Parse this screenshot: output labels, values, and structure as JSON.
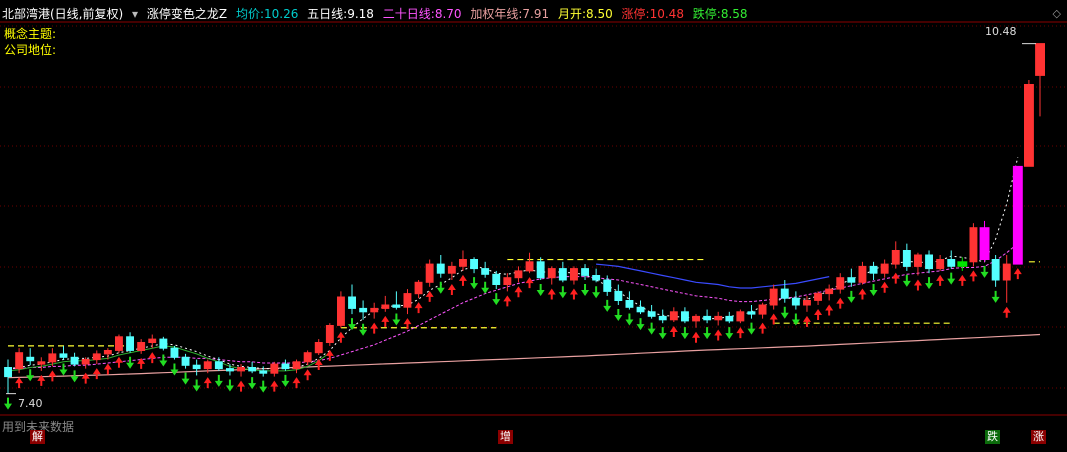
{
  "header": {
    "stock": "北部湾港(日线,前复权)",
    "indicator": "涨停变色之龙Z",
    "avg_label": "均价:",
    "avg_value": "10.26",
    "ma5_label": "五日线:",
    "ma5_value": "9.18",
    "ma20_label": "二十日线:",
    "ma20_value": "8.70",
    "wma_label": "加权年线:",
    "wma_value": "7.91",
    "open_label": "月开:",
    "open_value": "8.50",
    "up_label": "涨停:",
    "up_value": "10.48",
    "down_label": "跌停:",
    "down_value": "8.58"
  },
  "side": {
    "concept": "概念主题:",
    "position": "公司地位:"
  },
  "footer": {
    "note": "用到未来数据"
  },
  "markers": {
    "jie": "解",
    "zeng": "增",
    "die": "跌",
    "zhang": "涨"
  },
  "price_labels": {
    "high": "10.48",
    "low": "7.40"
  },
  "icons": {
    "collapse": "chevron-down-icon",
    "diamond": "diamond-icon"
  },
  "colors": {
    "up": "#ff3333",
    "down": "#54ffff",
    "limit_up": "#ff00ff",
    "limit_down": "#00e600",
    "ma5": "#ffffff",
    "ma20": "#ff55ff",
    "blue_line": "#3a4bff",
    "green_line": "#2fae2f",
    "year_line": "#e8a0a0",
    "dash": "#ffff33",
    "grid": "#6b0000"
  },
  "chart_data": {
    "type": "candlestick",
    "ylim": [
      7.3,
      10.6
    ],
    "candles": [
      {
        "o": 7.63,
        "h": 7.7,
        "l": 7.4,
        "c": 7.55
      },
      {
        "o": 7.62,
        "h": 7.8,
        "l": 7.58,
        "c": 7.76
      },
      {
        "o": 7.72,
        "h": 7.8,
        "l": 7.65,
        "c": 7.69
      },
      {
        "o": 7.66,
        "h": 7.72,
        "l": 7.6,
        "c": 7.68
      },
      {
        "o": 7.68,
        "h": 7.8,
        "l": 7.64,
        "c": 7.75
      },
      {
        "o": 7.75,
        "h": 7.82,
        "l": 7.7,
        "c": 7.72
      },
      {
        "o": 7.72,
        "h": 7.76,
        "l": 7.64,
        "c": 7.66
      },
      {
        "o": 7.66,
        "h": 7.72,
        "l": 7.62,
        "c": 7.7
      },
      {
        "o": 7.7,
        "h": 7.78,
        "l": 7.66,
        "c": 7.75
      },
      {
        "o": 7.75,
        "h": 7.8,
        "l": 7.7,
        "c": 7.78
      },
      {
        "o": 7.78,
        "h": 7.92,
        "l": 7.76,
        "c": 7.9
      },
      {
        "o": 7.9,
        "h": 7.94,
        "l": 7.76,
        "c": 7.78
      },
      {
        "o": 7.78,
        "h": 7.88,
        "l": 7.75,
        "c": 7.85
      },
      {
        "o": 7.85,
        "h": 7.92,
        "l": 7.8,
        "c": 7.88
      },
      {
        "o": 7.88,
        "h": 7.9,
        "l": 7.78,
        "c": 7.8
      },
      {
        "o": 7.8,
        "h": 7.82,
        "l": 7.7,
        "c": 7.72
      },
      {
        "o": 7.72,
        "h": 7.75,
        "l": 7.62,
        "c": 7.65
      },
      {
        "o": 7.65,
        "h": 7.7,
        "l": 7.56,
        "c": 7.62
      },
      {
        "o": 7.62,
        "h": 7.7,
        "l": 7.58,
        "c": 7.68
      },
      {
        "o": 7.68,
        "h": 7.72,
        "l": 7.6,
        "c": 7.62
      },
      {
        "o": 7.62,
        "h": 7.66,
        "l": 7.56,
        "c": 7.6
      },
      {
        "o": 7.6,
        "h": 7.66,
        "l": 7.55,
        "c": 7.63
      },
      {
        "o": 7.63,
        "h": 7.68,
        "l": 7.58,
        "c": 7.6
      },
      {
        "o": 7.6,
        "h": 7.64,
        "l": 7.55,
        "c": 7.58
      },
      {
        "o": 7.58,
        "h": 7.68,
        "l": 7.55,
        "c": 7.66
      },
      {
        "o": 7.66,
        "h": 7.7,
        "l": 7.6,
        "c": 7.62
      },
      {
        "o": 7.62,
        "h": 7.7,
        "l": 7.58,
        "c": 7.68
      },
      {
        "o": 7.68,
        "h": 7.78,
        "l": 7.65,
        "c": 7.76
      },
      {
        "o": 7.76,
        "h": 7.88,
        "l": 7.74,
        "c": 7.85
      },
      {
        "o": 7.85,
        "h": 8.02,
        "l": 7.82,
        "c": 8.0
      },
      {
        "o": 8.0,
        "h": 8.3,
        "l": 7.98,
        "c": 8.25
      },
      {
        "o": 8.25,
        "h": 8.36,
        "l": 8.1,
        "c": 8.15
      },
      {
        "o": 8.15,
        "h": 8.22,
        "l": 8.05,
        "c": 8.12
      },
      {
        "o": 8.12,
        "h": 8.2,
        "l": 8.06,
        "c": 8.15
      },
      {
        "o": 8.15,
        "h": 8.26,
        "l": 8.12,
        "c": 8.18
      },
      {
        "o": 8.18,
        "h": 8.3,
        "l": 8.14,
        "c": 8.16
      },
      {
        "o": 8.16,
        "h": 8.32,
        "l": 8.1,
        "c": 8.28
      },
      {
        "o": 8.28,
        "h": 8.4,
        "l": 8.24,
        "c": 8.38
      },
      {
        "o": 8.38,
        "h": 8.58,
        "l": 8.34,
        "c": 8.54
      },
      {
        "o": 8.54,
        "h": 8.62,
        "l": 8.42,
        "c": 8.46
      },
      {
        "o": 8.46,
        "h": 8.56,
        "l": 8.4,
        "c": 8.52
      },
      {
        "o": 8.52,
        "h": 8.66,
        "l": 8.48,
        "c": 8.58
      },
      {
        "o": 8.58,
        "h": 8.6,
        "l": 8.46,
        "c": 8.5
      },
      {
        "o": 8.5,
        "h": 8.56,
        "l": 8.42,
        "c": 8.45
      },
      {
        "o": 8.45,
        "h": 8.48,
        "l": 8.32,
        "c": 8.36
      },
      {
        "o": 8.36,
        "h": 8.46,
        "l": 8.3,
        "c": 8.42
      },
      {
        "o": 8.42,
        "h": 8.52,
        "l": 8.38,
        "c": 8.48
      },
      {
        "o": 8.48,
        "h": 8.64,
        "l": 8.46,
        "c": 8.56
      },
      {
        "o": 8.56,
        "h": 8.6,
        "l": 8.4,
        "c": 8.42
      },
      {
        "o": 8.42,
        "h": 8.52,
        "l": 8.36,
        "c": 8.5
      },
      {
        "o": 8.5,
        "h": 8.56,
        "l": 8.38,
        "c": 8.4
      },
      {
        "o": 8.4,
        "h": 8.52,
        "l": 8.36,
        "c": 8.5
      },
      {
        "o": 8.5,
        "h": 8.54,
        "l": 8.4,
        "c": 8.44
      },
      {
        "o": 8.44,
        "h": 8.5,
        "l": 8.38,
        "c": 8.4
      },
      {
        "o": 8.4,
        "h": 8.44,
        "l": 8.26,
        "c": 8.3
      },
      {
        "o": 8.3,
        "h": 8.36,
        "l": 8.18,
        "c": 8.22
      },
      {
        "o": 8.22,
        "h": 8.3,
        "l": 8.14,
        "c": 8.16
      },
      {
        "o": 8.16,
        "h": 8.22,
        "l": 8.1,
        "c": 8.12
      },
      {
        "o": 8.12,
        "h": 8.18,
        "l": 8.06,
        "c": 8.08
      },
      {
        "o": 8.08,
        "h": 8.14,
        "l": 8.02,
        "c": 8.05
      },
      {
        "o": 8.05,
        "h": 8.16,
        "l": 8.03,
        "c": 8.12
      },
      {
        "o": 8.12,
        "h": 8.16,
        "l": 8.02,
        "c": 8.04
      },
      {
        "o": 8.04,
        "h": 8.1,
        "l": 7.98,
        "c": 8.08
      },
      {
        "o": 8.08,
        "h": 8.14,
        "l": 8.02,
        "c": 8.05
      },
      {
        "o": 8.05,
        "h": 8.12,
        "l": 8.0,
        "c": 8.08
      },
      {
        "o": 8.08,
        "h": 8.12,
        "l": 8.02,
        "c": 8.04
      },
      {
        "o": 8.04,
        "h": 8.14,
        "l": 8.02,
        "c": 8.12
      },
      {
        "o": 8.12,
        "h": 8.18,
        "l": 8.06,
        "c": 8.1
      },
      {
        "o": 8.1,
        "h": 8.2,
        "l": 8.06,
        "c": 8.18
      },
      {
        "o": 8.18,
        "h": 8.36,
        "l": 8.14,
        "c": 8.32
      },
      {
        "o": 8.32,
        "h": 8.4,
        "l": 8.2,
        "c": 8.24
      },
      {
        "o": 8.24,
        "h": 8.3,
        "l": 8.14,
        "c": 8.18
      },
      {
        "o": 8.18,
        "h": 8.26,
        "l": 8.12,
        "c": 8.22
      },
      {
        "o": 8.22,
        "h": 8.3,
        "l": 8.18,
        "c": 8.28
      },
      {
        "o": 8.28,
        "h": 8.36,
        "l": 8.22,
        "c": 8.32
      },
      {
        "o": 8.32,
        "h": 8.46,
        "l": 8.28,
        "c": 8.42
      },
      {
        "o": 8.42,
        "h": 8.5,
        "l": 8.34,
        "c": 8.38
      },
      {
        "o": 8.38,
        "h": 8.56,
        "l": 8.36,
        "c": 8.52
      },
      {
        "o": 8.52,
        "h": 8.56,
        "l": 8.4,
        "c": 8.46
      },
      {
        "o": 8.46,
        "h": 8.58,
        "l": 8.42,
        "c": 8.54
      },
      {
        "o": 8.54,
        "h": 8.74,
        "l": 8.5,
        "c": 8.66
      },
      {
        "o": 8.66,
        "h": 8.72,
        "l": 8.48,
        "c": 8.52
      },
      {
        "o": 8.52,
        "h": 8.64,
        "l": 8.44,
        "c": 8.62
      },
      {
        "o": 8.62,
        "h": 8.66,
        "l": 8.46,
        "c": 8.5
      },
      {
        "o": 8.5,
        "h": 8.62,
        "l": 8.48,
        "c": 8.58
      },
      {
        "o": 8.58,
        "h": 8.66,
        "l": 8.5,
        "c": 8.52
      },
      {
        "o": 8.52,
        "h": 8.6,
        "l": 8.48,
        "c": 8.56
      },
      {
        "o": 8.56,
        "h": 8.9,
        "l": 8.52,
        "c": 8.86
      },
      {
        "o": 8.86,
        "h": 8.92,
        "l": 8.56,
        "c": 8.58
      },
      {
        "o": 8.58,
        "h": 8.62,
        "l": 8.34,
        "c": 8.4
      },
      {
        "o": 8.4,
        "h": 8.62,
        "l": 8.2,
        "c": 8.54
      },
      {
        "o": 8.54,
        "h": 9.4,
        "l": 8.54,
        "c": 9.4
      },
      {
        "o": 9.4,
        "h": 10.16,
        "l": 9.4,
        "c": 10.12
      },
      {
        "o": 10.2,
        "h": 10.48,
        "l": 9.84,
        "c": 10.48
      }
    ],
    "limit_up_index": [
      88,
      91
    ],
    "limit_down_index": [
      86
    ],
    "ma5": [
      7.62,
      7.63,
      7.65,
      7.66,
      7.68,
      7.7,
      7.71,
      7.71,
      7.72,
      7.73,
      7.76,
      7.78,
      7.8,
      7.82,
      7.84,
      7.83,
      7.8,
      7.77,
      7.73,
      7.7,
      7.66,
      7.64,
      7.63,
      7.62,
      7.62,
      7.62,
      7.63,
      7.66,
      7.71,
      7.78,
      7.89,
      7.98,
      8.06,
      8.13,
      8.17,
      8.17,
      8.18,
      8.23,
      8.31,
      8.36,
      8.42,
      8.49,
      8.52,
      8.5,
      8.46,
      8.45,
      8.47,
      8.49,
      8.47,
      8.47,
      8.47,
      8.46,
      8.45,
      8.4,
      8.35,
      8.3,
      8.23,
      8.17,
      8.11,
      8.09,
      8.08,
      8.07,
      8.07,
      8.06,
      8.06,
      8.08,
      8.09,
      8.12,
      8.17,
      8.21,
      8.24,
      8.24,
      8.23,
      8.26,
      8.31,
      8.36,
      8.41,
      8.44,
      8.49,
      8.53,
      8.55,
      8.56,
      8.56,
      8.55,
      8.57,
      8.61,
      8.6,
      8.58,
      8.56,
      8.76,
      9.07,
      9.48
    ],
    "ma20": [
      7.62,
      7.62,
      7.63,
      7.63,
      7.64,
      7.64,
      7.65,
      7.65,
      7.66,
      7.67,
      7.68,
      7.69,
      7.7,
      7.71,
      7.72,
      7.72,
      7.72,
      7.71,
      7.71,
      7.7,
      7.69,
      7.68,
      7.68,
      7.67,
      7.67,
      7.67,
      7.67,
      7.68,
      7.69,
      7.71,
      7.74,
      7.77,
      7.8,
      7.83,
      7.87,
      7.91,
      7.95,
      8.0,
      8.05,
      8.1,
      8.15,
      8.2,
      8.24,
      8.28,
      8.31,
      8.34,
      8.37,
      8.39,
      8.41,
      8.42,
      8.43,
      8.43,
      8.43,
      8.42,
      8.41,
      8.4,
      8.38,
      8.36,
      8.34,
      8.32,
      8.3,
      8.28,
      8.26,
      8.25,
      8.24,
      8.22,
      8.21,
      8.21,
      8.22,
      8.23,
      8.24,
      8.25,
      8.27,
      8.29,
      8.31,
      8.33,
      8.35,
      8.37,
      8.39,
      8.41,
      8.43,
      8.45,
      8.46,
      8.47,
      8.48,
      8.5,
      8.51,
      8.51,
      8.52,
      8.57,
      8.64,
      8.72
    ],
    "blue_line_start": 53,
    "year_line": [
      7.54,
      7.57,
      7.61,
      7.65,
      7.69,
      7.73,
      7.78,
      7.82,
      7.87,
      7.92
    ],
    "dashes": [
      {
        "price": 7.82,
        "from": 0,
        "to": 12
      },
      {
        "price": 8.58,
        "from": 45,
        "to": 63
      },
      {
        "price": 7.98,
        "from": 30,
        "to": 44
      },
      {
        "price": 8.02,
        "from": 69,
        "to": 85
      },
      {
        "price": 8.56,
        "from": 92,
        "to": 93
      }
    ]
  }
}
